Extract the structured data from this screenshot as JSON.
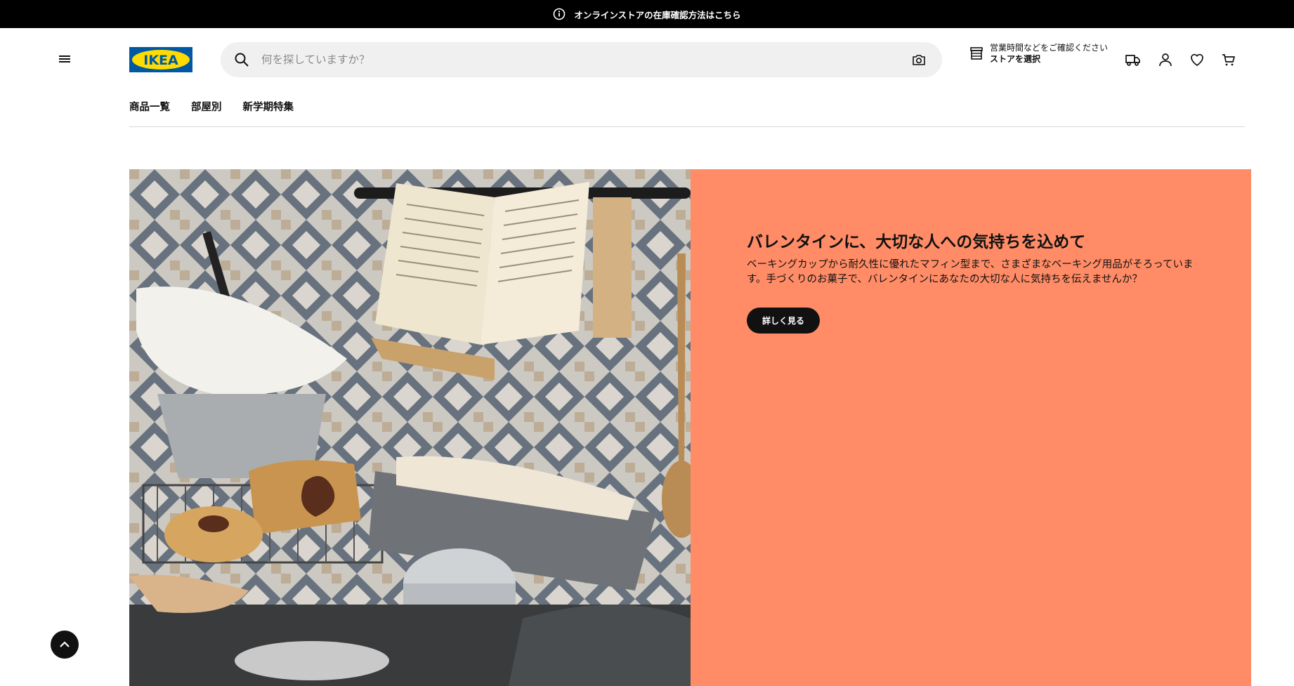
{
  "announcement": {
    "text": "オンラインストアの在庫確認方法はこちら",
    "icon": "info-icon"
  },
  "header": {
    "logo_text": "IKEA",
    "search": {
      "placeholder": "何を探していますか？",
      "value": ""
    },
    "store": {
      "hours_text": "営業時間などをご確認ください",
      "select_label": "ストアを選択"
    },
    "icons": [
      "delivery-truck-icon",
      "account-icon",
      "wishlist-heart-icon",
      "cart-icon"
    ]
  },
  "nav": {
    "items": [
      "商品一覧",
      "部屋別",
      "新学期特集"
    ]
  },
  "hero": {
    "title": "バレンタインに、大切な人への気持ちを込めて",
    "description": "ベーキングカップから耐久性に優れたマフィン型まで、さまざまなベーキング用品がそろっています。手づくりのお菓子で、バレンタインにあなたの大切な人に気持ちを伝えませんか？",
    "button_label": "詳しく見る",
    "image_alt": "baking-scene-photo"
  },
  "colors": {
    "brand_blue": "#0058a3",
    "brand_yellow": "#ffdb00",
    "hero_bg": "#ff8c66",
    "topbar_bg": "#000000"
  }
}
